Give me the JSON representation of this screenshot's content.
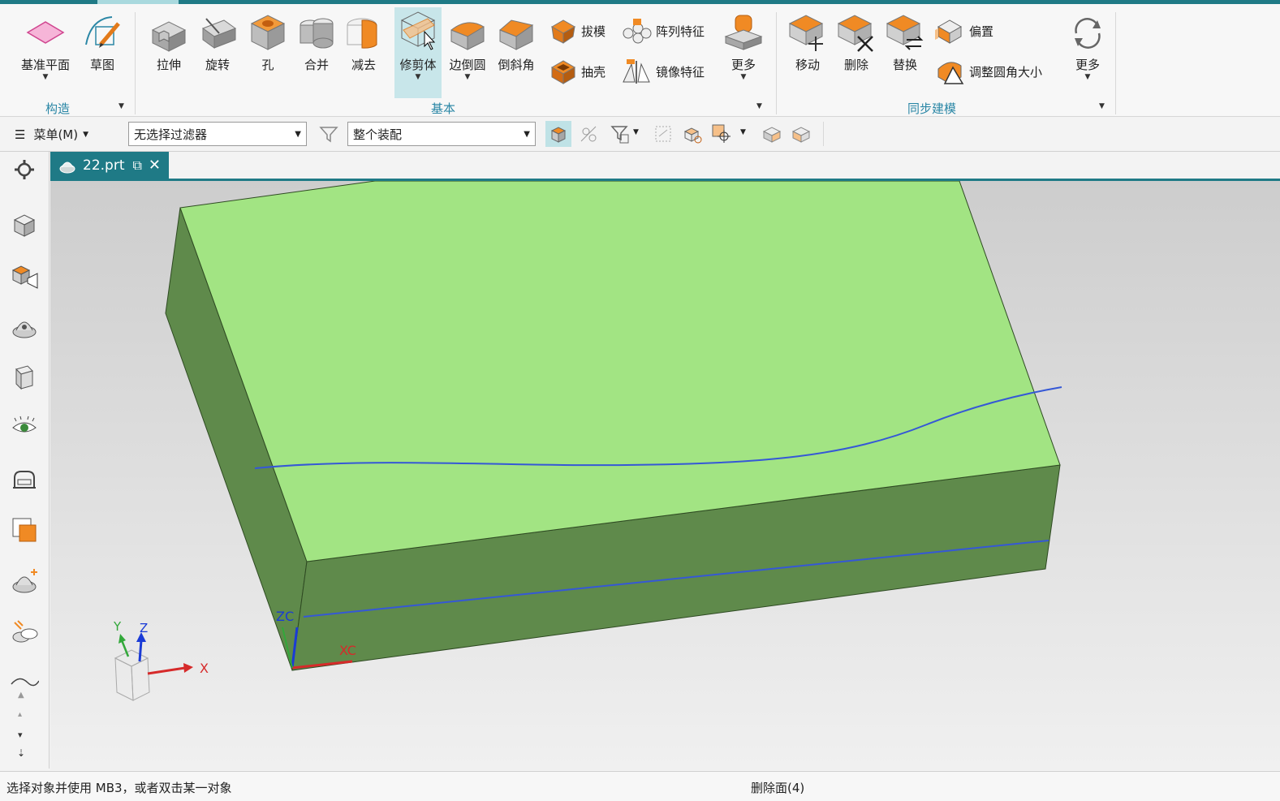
{
  "ribbon": {
    "construct": {
      "datum_plane": "基准平面",
      "sketch": "草图",
      "group_label": "构造"
    },
    "basic": {
      "extrude": "拉伸",
      "revolve": "旋转",
      "hole": "孔",
      "unite": "合并",
      "subtract": "减去",
      "trim_body": "修剪体",
      "edge_blend": "边倒圆",
      "chamfer": "倒斜角",
      "draft": "拔模",
      "shell": "抽壳",
      "pattern_feature": "阵列特征",
      "mirror_feature": "镜像特征",
      "more": "更多",
      "group_label": "基本"
    },
    "sync": {
      "move": "移动",
      "delete": "删除",
      "replace": "替换",
      "offset": "偏置",
      "resize_blend": "调整圆角大小",
      "more": "更多",
      "group_label": "同步建模"
    }
  },
  "toolbar2": {
    "menu_label": "菜单(M)",
    "filter_value": "无选择过滤器",
    "scope_value": "整个装配"
  },
  "tab": {
    "label": "22.prt"
  },
  "triad": {
    "y": "Y",
    "z": "Z",
    "x": "X",
    "zc": "ZC",
    "xc": "XC"
  },
  "status": {
    "prompt": "选择对象并使用 MB3，或者双击某一对象",
    "message": "删除面(4)"
  },
  "colors": {
    "accent": "#1f7a86",
    "top_face": "#a2e483",
    "side_face": "#5f8a4b",
    "curve": "#3558d6",
    "icon_orange": "#f08a24"
  }
}
